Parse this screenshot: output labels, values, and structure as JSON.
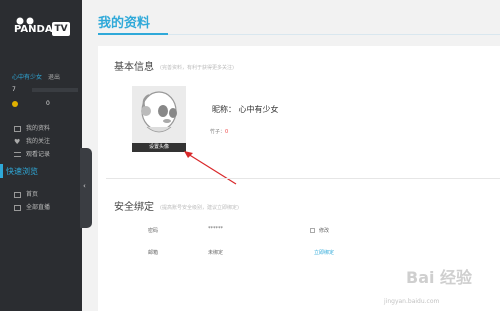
{
  "brand": {
    "logo_text": "PANDA",
    "logo_badge": "TV"
  },
  "sidebar": {
    "username": "心中有少女",
    "logout": "退出",
    "bamboo_count": "7",
    "maobi_count": "0",
    "menu": [
      {
        "label": "我的资料",
        "icon": "profile-icon"
      },
      {
        "label": "我的关注",
        "icon": "heart-icon"
      },
      {
        "label": "观看记录",
        "icon": "history-icon"
      }
    ],
    "quick_label": "快速浏览",
    "nav": [
      {
        "label": "首页",
        "icon": "home-icon"
      },
      {
        "label": "全部直播",
        "icon": "live-icon"
      }
    ]
  },
  "main": {
    "page_title": "我的资料",
    "basic": {
      "heading": "基本信息",
      "hint": "(完善资料，有利于获得更多关注)",
      "avatar_button": "设置头像",
      "nickname": "昵称： 心中有少女",
      "bamboo_label": "竹子：",
      "bamboo_value": "0"
    },
    "security": {
      "heading": "安全绑定",
      "hint": "(提高账号安全级别，建议立即绑定)",
      "password_label": "密码",
      "password_value": "******",
      "password_action": "修改",
      "email_label": "邮箱",
      "email_value": "未绑定",
      "email_action": "立即绑定"
    }
  },
  "watermark": {
    "big": "Bai 经验",
    "url": "jingyan.baidu.com"
  },
  "colors": {
    "accent": "#2fa9d9",
    "sidebar": "#2b2d31",
    "arrow": "#d9282a"
  }
}
